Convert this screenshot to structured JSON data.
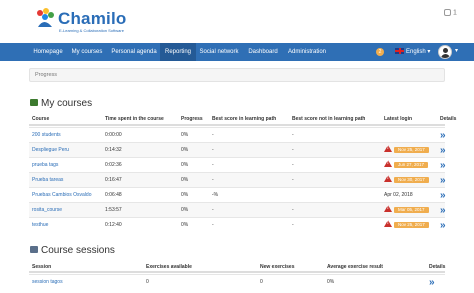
{
  "header": {
    "logo_title": "Chamilo",
    "logo_subtitle": "E-Learning & Collaboration Software",
    "user_count": "1"
  },
  "nav": {
    "items": [
      "Homepage",
      "My courses",
      "Personal agenda",
      "Reporting",
      "Social network",
      "Dashboard",
      "Administration"
    ],
    "active": "Reporting",
    "notification_count": "2",
    "language": "English"
  },
  "breadcrumb": "Progress",
  "my_courses": {
    "title": "My courses",
    "headers": [
      "Course",
      "Time spent in the course",
      "Progress",
      "Best score in learning path",
      "Best score not in learning path",
      "Latest login",
      "Details"
    ],
    "rows": [
      {
        "course": "200 students",
        "time": "0:00:00",
        "progress": "0%",
        "best_lp": "-",
        "best_not_lp": "-",
        "latest": "",
        "latest_warn": false
      },
      {
        "course": "Despliegue Peru",
        "time": "0:14:32",
        "progress": "0%",
        "best_lp": "-",
        "best_not_lp": "-",
        "latest": "Nov 25, 2017",
        "latest_warn": true
      },
      {
        "course": "prueba tags",
        "time": "0:02:36",
        "progress": "0%",
        "best_lp": "-",
        "best_not_lp": "-",
        "latest": "Jun 27, 2017",
        "latest_warn": true
      },
      {
        "course": "Prueba tareas",
        "time": "0:16:47",
        "progress": "0%",
        "best_lp": "-",
        "best_not_lp": "-",
        "latest": "Nov 30, 2017",
        "latest_warn": true
      },
      {
        "course": "Pruebas Cambios Osvaldo",
        "time": "0:06:48",
        "progress": "0%",
        "best_lp": "-",
        "best_not_lp": "-%",
        "latest": "Apr 02, 2018",
        "latest_warn": false
      },
      {
        "course": "rosita_course",
        "time": "1:53:57",
        "progress": "0%",
        "best_lp": "-",
        "best_not_lp": "-",
        "latest": "Mar 05, 2017",
        "latest_warn": true
      },
      {
        "course": "testhue",
        "time": "0:12:40",
        "progress": "0%",
        "best_lp": "-",
        "best_not_lp": "-",
        "latest": "Nov 25, 2017",
        "latest_warn": true
      }
    ]
  },
  "course_sessions": {
    "title": "Course sessions",
    "headers": [
      "Session",
      "Exercises available",
      "New exercises",
      "Average exercise result",
      "Details"
    ],
    "rows": [
      {
        "session": "session tagos",
        "exercises": "0",
        "new": "0",
        "avg": "0%"
      }
    ]
  }
}
